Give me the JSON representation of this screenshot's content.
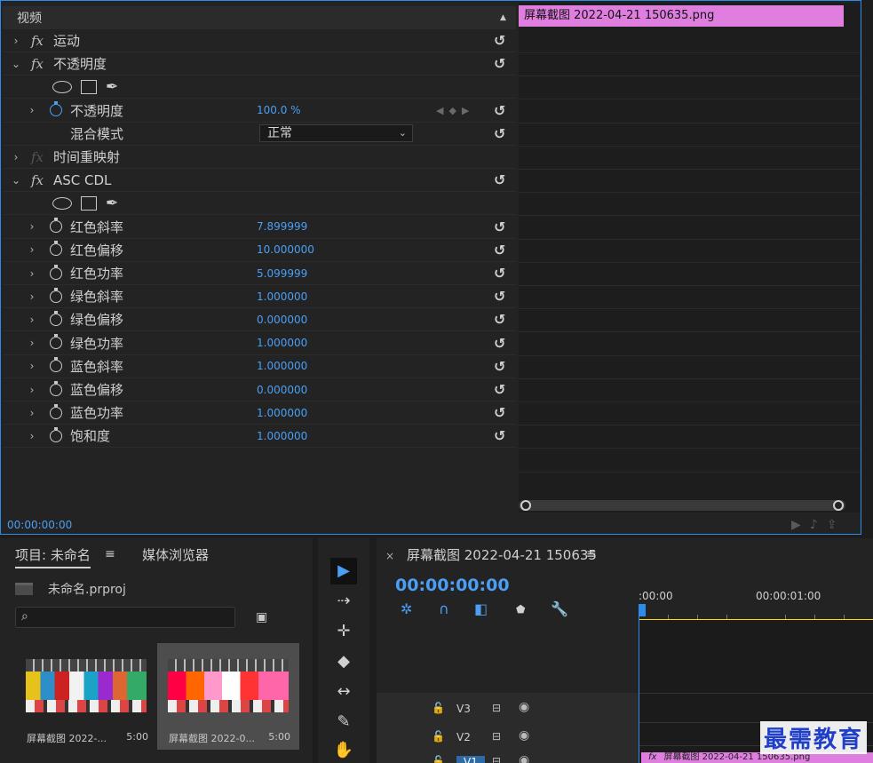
{
  "effect_controls": {
    "section_label": "视频",
    "rows": [
      {
        "type": "effect",
        "label": "运动",
        "expanded": false,
        "fx": true
      },
      {
        "type": "effect",
        "label": "不透明度",
        "expanded": true,
        "fx": true
      },
      {
        "type": "shapes"
      },
      {
        "type": "param",
        "label": "不透明度",
        "value": "100.0 %",
        "stopwatch_active": true,
        "keyframes": true
      },
      {
        "type": "blend",
        "label": "混合模式",
        "value": "正常"
      },
      {
        "type": "effect",
        "label": "时间重映射",
        "expanded": false,
        "fx": true,
        "fx_dim": true
      },
      {
        "type": "effect",
        "label": "ASC CDL",
        "expanded": true,
        "fx": true
      },
      {
        "type": "shapes"
      },
      {
        "type": "param",
        "label": "红色斜率",
        "value": "7.899999"
      },
      {
        "type": "param",
        "label": "红色偏移",
        "value": "10.000000"
      },
      {
        "type": "param",
        "label": "红色功率",
        "value": "5.099999"
      },
      {
        "type": "param",
        "label": "绿色斜率",
        "value": "1.000000"
      },
      {
        "type": "param",
        "label": "绿色偏移",
        "value": "0.000000"
      },
      {
        "type": "param",
        "label": "绿色功率",
        "value": "1.000000"
      },
      {
        "type": "param",
        "label": "蓝色斜率",
        "value": "1.000000"
      },
      {
        "type": "param",
        "label": "蓝色偏移",
        "value": "0.000000"
      },
      {
        "type": "param",
        "label": "蓝色功率",
        "value": "1.000000"
      },
      {
        "type": "param",
        "label": "饱和度",
        "value": "1.000000"
      }
    ],
    "timecode": "00:00:00:00",
    "mini_clip_label": "屏幕截图 2022-04-21  150635.png"
  },
  "project": {
    "tab_active": "项目: 未命名",
    "tab_other": "媒体浏览器",
    "file_name": "未命名.prproj",
    "search_placeholder": "",
    "items": [
      {
        "name": "屏幕截图 2022-...",
        "duration": "5:00"
      },
      {
        "name": "屏幕截图 2022-0...",
        "duration": "5:00"
      }
    ]
  },
  "timeline": {
    "title": "屏幕截图 2022-04-21 150635",
    "timecode": "00:00:00:00",
    "ruler_labels": [
      ":00:00",
      "00:00:01:00"
    ],
    "tracks": [
      "V3",
      "V2",
      "V1"
    ],
    "clip_label": "屏幕截图 2022-04-21  150635.png"
  },
  "watermark": "最需教育",
  "colors": {
    "accent_blue": "#4a9ff5",
    "clip_pink": "#e07ee0",
    "playhead_blue": "#2d8ceb",
    "work_area_yellow": "#ffe000"
  }
}
